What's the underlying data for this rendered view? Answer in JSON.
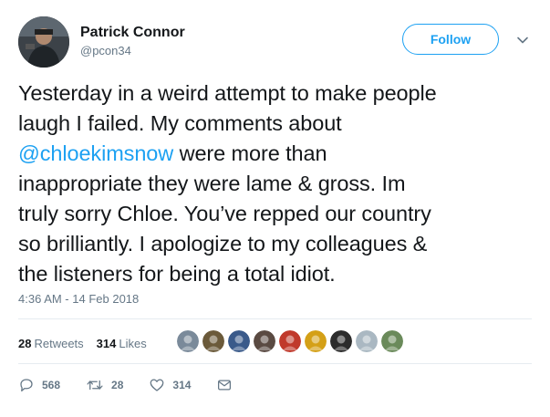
{
  "author": {
    "display_name": "Patrick Connor",
    "handle": "@pcon34"
  },
  "follow_button": {
    "label": "Follow"
  },
  "tweet": {
    "lines": [
      {
        "before": "Yesterday in a weird attempt to make people",
        "mention": "",
        "after": ""
      },
      {
        "before": "laugh I failed. My comments about",
        "mention": "",
        "after": ""
      },
      {
        "before": "",
        "mention": "@chloekimsnow",
        "after": " were more than"
      },
      {
        "before": "inappropriate they were lame & gross. Im",
        "mention": "",
        "after": ""
      },
      {
        "before": "truly sorry Chloe. You’ve repped our country",
        "mention": "",
        "after": ""
      },
      {
        "before": "so brilliantly. I apologize to my colleagues &",
        "mention": "",
        "after": ""
      },
      {
        "before": "the listeners for being a total idiot.",
        "mention": "",
        "after": ""
      }
    ],
    "timestamp": "4:36 AM - 14 Feb 2018"
  },
  "stats": {
    "retweets_count": "28",
    "retweets_label": "Retweets",
    "likes_count": "314",
    "likes_label": "Likes"
  },
  "likers": [
    {
      "icon": "liker-avatar-1",
      "color": "#7a8a9a"
    },
    {
      "icon": "liker-avatar-2",
      "color": "#6b5a3a"
    },
    {
      "icon": "liker-avatar-3",
      "color": "#3a5a8a"
    },
    {
      "icon": "liker-avatar-4",
      "color": "#5a4a42"
    },
    {
      "icon": "liker-avatar-5",
      "color": "#c0392b"
    },
    {
      "icon": "liker-avatar-6",
      "color": "#d4a017"
    },
    {
      "icon": "liker-avatar-7",
      "color": "#2c2c2c"
    },
    {
      "icon": "liker-avatar-8",
      "color": "#aab8c2"
    },
    {
      "icon": "liker-avatar-9",
      "color": "#6a8a5a"
    }
  ],
  "actions": {
    "reply_count": "568",
    "retweet_count": "28",
    "like_count": "314"
  },
  "colors": {
    "accent": "#1da1f2",
    "text": "#14171a",
    "secondary": "#657786",
    "divider": "#e6ecf0"
  }
}
